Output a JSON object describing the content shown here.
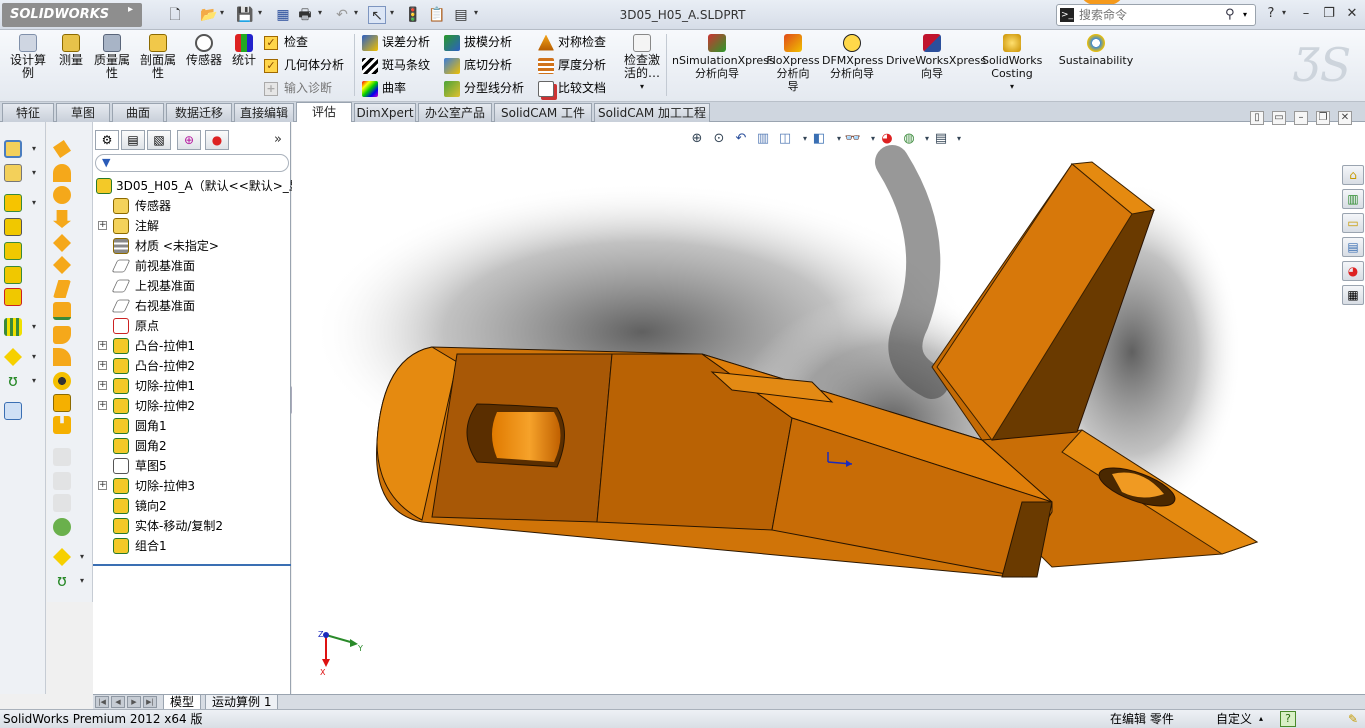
{
  "app": {
    "logo_text": "SOLIDWORKS",
    "document_title": "3D05_H05_A.SLDPRT"
  },
  "search": {
    "placeholder": "搜索命令"
  },
  "ribbon": {
    "large_buttons": [
      {
        "label": "设计算\n例",
        "icon": "design-study-icon"
      },
      {
        "label": "测量",
        "icon": "measure-icon"
      },
      {
        "label": "质量属\n性",
        "icon": "mass-properties-icon"
      },
      {
        "label": "剖面属\n性",
        "icon": "section-properties-icon"
      },
      {
        "label": "传感器",
        "icon": "sensor-icon"
      },
      {
        "label": "统计",
        "icon": "statistics-icon"
      }
    ],
    "check_items": [
      {
        "label": "检查"
      },
      {
        "label": "几何体分析"
      },
      {
        "label": "输入诊断"
      }
    ],
    "analysis_col1": [
      {
        "label": "误差分析",
        "icon": "deviation-analysis-icon"
      },
      {
        "label": "斑马条纹",
        "icon": "zebra-stripes-icon"
      },
      {
        "label": "曲率",
        "icon": "curvature-icon"
      }
    ],
    "analysis_col2": [
      {
        "label": "拔模分析",
        "icon": "draft-analysis-icon"
      },
      {
        "label": "底切分析",
        "icon": "undercut-analysis-icon"
      },
      {
        "label": "分型线分析",
        "icon": "parting-line-analysis-icon"
      }
    ],
    "analysis_col3": [
      {
        "label": "对称检查",
        "icon": "symmetry-check-icon"
      },
      {
        "label": "厚度分析",
        "icon": "thickness-analysis-icon"
      },
      {
        "label": "比较文档",
        "icon": "compare-documents-icon"
      }
    ],
    "check_active": {
      "label": "检查激\n活的…"
    },
    "addins": [
      {
        "label": "nSimulationXpress\n分析向导",
        "icon": "simulationxpress-icon"
      },
      {
        "label": "FloXpress\n分析向\n导",
        "icon": "floxpress-icon"
      },
      {
        "label": "DFMXpress\n分析向导",
        "icon": "dfmxpress-icon"
      },
      {
        "label": "DriveWorksXpress\n向导",
        "icon": "driveworksxpress-icon"
      },
      {
        "label": "SolidWorks\nCosting",
        "icon": "costing-icon"
      },
      {
        "label": "Sustainability",
        "icon": "sustainability-icon"
      }
    ]
  },
  "tabs": [
    {
      "label": "特征"
    },
    {
      "label": "草图"
    },
    {
      "label": "曲面"
    },
    {
      "label": "数据迁移"
    },
    {
      "label": "直接编辑"
    },
    {
      "label": "评估"
    },
    {
      "label": "DimXpert"
    },
    {
      "label": "办公室产品"
    },
    {
      "label": "SolidCAM 工件"
    },
    {
      "label": "SolidCAM 加工工程"
    }
  ],
  "tree": {
    "root": "3D05_H05_A（默认<<默认>_显",
    "items": [
      {
        "label": "传感器",
        "icon": "sensor-folder-icon",
        "expandable": false
      },
      {
        "label": "注解",
        "icon": "annotations-icon",
        "expandable": true
      },
      {
        "label": "材质 <未指定>",
        "icon": "material-icon",
        "expandable": false
      },
      {
        "label": "前视基准面",
        "icon": "plane-icon",
        "expandable": false
      },
      {
        "label": "上视基准面",
        "icon": "plane-icon",
        "expandable": false
      },
      {
        "label": "右视基准面",
        "icon": "plane-icon",
        "expandable": false
      },
      {
        "label": "原点",
        "icon": "origin-icon",
        "expandable": false
      },
      {
        "label": "凸台-拉伸1",
        "icon": "boss-extrude-icon",
        "expandable": true
      },
      {
        "label": "凸台-拉伸2",
        "icon": "boss-extrude-icon",
        "expandable": true
      },
      {
        "label": "切除-拉伸1",
        "icon": "cut-extrude-icon",
        "expandable": true
      },
      {
        "label": "切除-拉伸2",
        "icon": "cut-extrude-icon",
        "expandable": true
      },
      {
        "label": "圆角1",
        "icon": "fillet-icon",
        "expandable": false
      },
      {
        "label": "圆角2",
        "icon": "fillet-icon",
        "expandable": false
      },
      {
        "label": "草图5",
        "icon": "sketch-icon",
        "expandable": false
      },
      {
        "label": "切除-拉伸3",
        "icon": "cut-extrude-icon",
        "expandable": true
      },
      {
        "label": "镜向2",
        "icon": "mirror-icon",
        "expandable": false
      },
      {
        "label": "实体-移动/复制2",
        "icon": "move-copy-body-icon",
        "expandable": false
      },
      {
        "label": "组合1",
        "icon": "combine-icon",
        "expandable": false
      }
    ]
  },
  "bottom_tabs": [
    {
      "label": "模型"
    },
    {
      "label": "运动算例 1"
    }
  ],
  "status": {
    "product": "SolidWorks Premium 2012 x64 版",
    "mode": "在编辑 零件",
    "units": "自定义"
  },
  "colors": {
    "part": "#d97a0a",
    "accent": "#3a6fb3"
  }
}
